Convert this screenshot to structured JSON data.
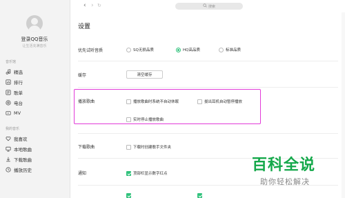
{
  "sidebar": {
    "login_text": "登录QQ音乐",
    "login_sub": "让生活充满音乐",
    "section_online": "音乐馆",
    "online_items": [
      {
        "label": "精选",
        "icon": "music-note-icon"
      },
      {
        "label": "排行",
        "icon": "chart-icon"
      },
      {
        "label": "歌单",
        "icon": "playlist-icon"
      },
      {
        "label": "电台",
        "icon": "radio-icon"
      },
      {
        "label": "MV",
        "icon": "video-icon"
      }
    ],
    "section_mine": "我的音乐",
    "mine_items": [
      {
        "label": "我喜欢",
        "icon": "heart-icon"
      },
      {
        "label": "本地歌曲",
        "icon": "computer-icon"
      },
      {
        "label": "下载歌曲",
        "icon": "download-icon"
      },
      {
        "label": "播放历史",
        "icon": "history-icon"
      }
    ]
  },
  "topbar": {
    "back": "‹",
    "forward": "›",
    "refresh": "↻",
    "search_placeholder": "搜索"
  },
  "settings": {
    "title": "设置",
    "quality": {
      "label": "优先试听音质",
      "options": [
        "SQ无损品质",
        "HQ高品质",
        "标准品质"
      ],
      "selected": "HQ高品质"
    },
    "cache": {
      "label": "缓存",
      "button": "清空缓存"
    },
    "playback": {
      "label": "播放歌曲",
      "options": [
        {
          "label": "播放歌曲时系统不自动休眠",
          "checked": false
        },
        {
          "label": "拔出耳机自动暂停播放",
          "checked": false
        },
        {
          "label": "实时停止播放歌曲",
          "checked": false
        }
      ]
    },
    "download": {
      "label": "下载歌曲",
      "option": {
        "label": "下载时创建歌手文件夹",
        "checked": false
      }
    },
    "notify": {
      "label": "通知",
      "option": {
        "label": "顶部栏显示数字红点",
        "checked": true
      }
    }
  },
  "watermark": {
    "main": "百科全说",
    "sub": "助你轻松解决"
  },
  "colors": {
    "accent": "#31c27c",
    "highlight": "#e23ad8",
    "watermark": "#14a84a"
  }
}
